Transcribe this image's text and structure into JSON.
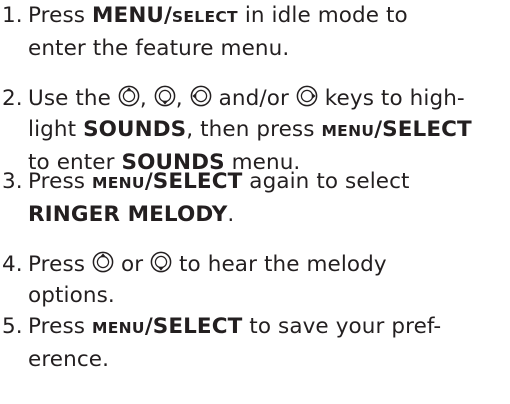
{
  "steps": [
    {
      "number": "1.",
      "lines": [
        [
          "Press ",
          "MENU",
          "/",
          "SELECT",
          " in idle mode to"
        ],
        [
          "enter the feature menu."
        ]
      ]
    },
    {
      "number": "2.",
      "lines": [
        [
          "Use the ",
          ", ",
          ", ",
          " and/or ",
          " keys to high-"
        ],
        [
          "light ",
          "SOUNDS",
          ", then press ",
          "MENU",
          "/SELECT"
        ],
        [
          "to enter ",
          "SOUNDS",
          " menu."
        ]
      ]
    },
    {
      "number": "3.",
      "lines": [
        [
          "Press ",
          "MENU",
          "/SELECT",
          " again to select"
        ],
        [
          "RINGER MELODY",
          "."
        ]
      ]
    },
    {
      "number": "4.",
      "lines": [
        [
          "Press ",
          " or ",
          " to hear the melody"
        ],
        [
          "options."
        ]
      ]
    },
    {
      "number": "5.",
      "lines": [
        [
          "Press ",
          "MENU",
          "/SELECT",
          " to save your pref-"
        ],
        [
          "erence."
        ]
      ]
    }
  ],
  "icons": {
    "up": "nav-up-key-icon",
    "down": "nav-down-key-icon",
    "left": "nav-left-key-icon",
    "right": "nav-right-key-icon"
  },
  "colors": {
    "text": "#231f20",
    "background": "#ffffff"
  }
}
